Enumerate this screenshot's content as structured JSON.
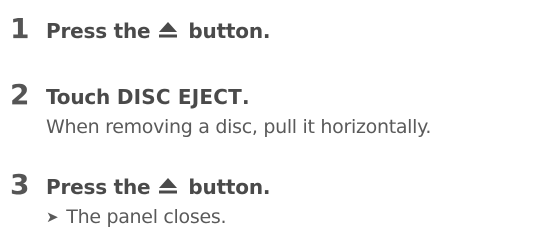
{
  "steps": [
    {
      "number": "1",
      "text_before": "Press the",
      "icon": "eject-icon",
      "text_after": "button."
    },
    {
      "number": "2",
      "text_before": "Touch",
      "highlight": "DISC EJECT",
      "text_after": ".",
      "note": "When removing a disc, pull it horizontally."
    },
    {
      "number": "3",
      "text_before": "Press the",
      "icon": "eject-icon",
      "text_after": "button.",
      "result": "The panel closes.",
      "result_marker": "➤"
    }
  ],
  "colors": {
    "number": "#555555",
    "text": "#4a4a4a",
    "note": "#5a5a5a"
  }
}
